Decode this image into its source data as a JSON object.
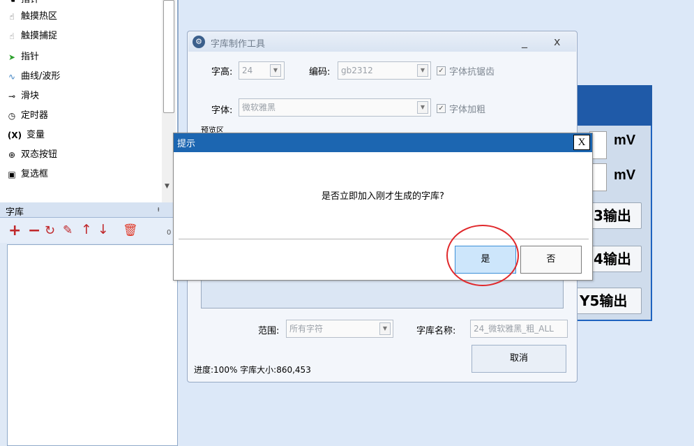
{
  "toolbox": {
    "items": [
      {
        "label": "指针",
        "icon": "hand-icon"
      },
      {
        "label": "触摸热区",
        "icon": "hand-pointer-icon"
      },
      {
        "label": "触摸捕捉",
        "icon": "hand-touch-icon"
      },
      {
        "label": "指针",
        "icon": "arrow-cursor-icon"
      },
      {
        "label": "曲线/波形",
        "icon": "wave-icon"
      },
      {
        "label": "滑块",
        "icon": "slider-icon"
      },
      {
        "label": "定时器",
        "icon": "clock-icon"
      },
      {
        "label": "变量",
        "icon": "variable-icon"
      },
      {
        "label": "双态按钮",
        "icon": "toggle-button-icon"
      },
      {
        "label": "复选框",
        "icon": "checkbox-icon"
      }
    ],
    "variable_glyph": "(X)"
  },
  "font_library_panel": {
    "title": "字库",
    "pin": "ᵼ",
    "count": "0"
  },
  "widget": {
    "unit_1": "mV",
    "unit_2": "mV",
    "btn_3": "3输出",
    "btn_4": "4输出",
    "btn_5": "Y5输出"
  },
  "font_tool": {
    "title": "字库制作工具",
    "minimize": "_",
    "close": "x",
    "height_label": "字高:",
    "height_value": "24",
    "encoding_label": "编码:",
    "encoding_value": "gb2312",
    "antialias_label": "字体抗锯齿",
    "font_label": "字体:",
    "font_value": "微软雅黑",
    "bold_label": "字体加粗",
    "preview_label": "预览区",
    "range_label": "范围:",
    "range_value": "所有字符",
    "libname_label": "字库名称:",
    "libname_value": "24_微软雅黑_粗_ALL",
    "cancel_label": "取消",
    "progress_text": "进度:100%  字库大小:860,453"
  },
  "dialog": {
    "title": "提示",
    "close_label": "X",
    "message": "是否立即加入刚才生成的字库?",
    "yes_label": "是",
    "no_label": "否"
  },
  "colors": {
    "dialog_title_bar": "#1c66b1",
    "highlight_circle": "#e0282b",
    "delete_icon": "#e03a2a",
    "library_icons": "#c0282b"
  }
}
